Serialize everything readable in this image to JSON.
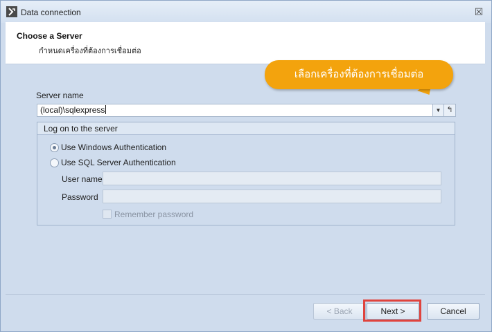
{
  "window": {
    "title": "Data connection",
    "close_glyph": "☒"
  },
  "header": {
    "title": "Choose a Server",
    "subtitle": "กำหนดเครื่องที่ต้องการเชื่อมต่อ"
  },
  "callout": {
    "text": "เลือกเครื่องที่ต้องการเชื่อมต่อ",
    "color": "#f3a30d"
  },
  "server": {
    "label": "Server name",
    "value": "(local)\\sqlexpress",
    "dropdown_icon": "chevron-down-icon",
    "refresh_icon": "refresh-icon"
  },
  "logon": {
    "group_title": "Log on to the server",
    "windows_auth_label": "Use Windows Authentication",
    "sql_auth_label": "Use SQL Server Authentication",
    "selected": "windows",
    "username_label": "User name",
    "username_value": "",
    "password_label": "Password",
    "password_value": "",
    "remember_label": "Remember password",
    "remember_checked": false
  },
  "buttons": {
    "back": "< Back",
    "next": "Next >",
    "cancel": "Cancel"
  },
  "colors": {
    "highlight": "#e0433d",
    "background": "#cfdced"
  }
}
